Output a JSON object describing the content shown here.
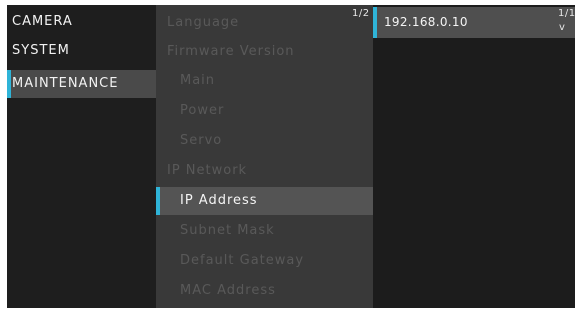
{
  "menu": {
    "main_items": [
      {
        "label": "CAMERA"
      },
      {
        "label": "SYSTEM"
      },
      {
        "label": "MAINTENANCE"
      }
    ],
    "sub_items": [
      {
        "label": "Language"
      },
      {
        "label": "Firmware Version"
      },
      {
        "label": "Main"
      },
      {
        "label": "Power"
      },
      {
        "label": "Servo"
      },
      {
        "label": "IP Network"
      },
      {
        "label": "IP Address"
      },
      {
        "label": "Subnet Mask"
      },
      {
        "label": "Default Gateway"
      },
      {
        "label": "MAC Address"
      }
    ],
    "sub_page_indicator": "1/2",
    "value": {
      "text": "192.168.0.10",
      "page_indicator": "1/1",
      "more_glyph": "v"
    }
  },
  "colors": {
    "accent": "#2fb4d8",
    "selected_bg": "#545454",
    "panel_bg": "#393939",
    "screen_bg": "#1c1c1c",
    "dim_text": "#595959"
  }
}
